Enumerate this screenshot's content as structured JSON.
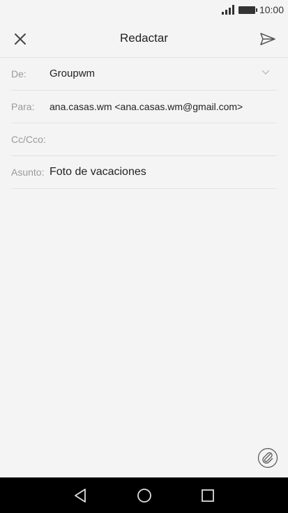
{
  "status_bar": {
    "time": "10:00",
    "icons": [
      "signal-icon",
      "battery-icon"
    ]
  },
  "header": {
    "title": "Redactar",
    "left_icon": "close-icon",
    "right_icon": "send-icon"
  },
  "form": {
    "from": {
      "label": "De:",
      "value": "Groupwm",
      "icon": "chevron-down-icon"
    },
    "to": {
      "label": "Para:",
      "value": "ana.casas.wm <ana.casas.wm@gmail.com>"
    },
    "cc_bcc": {
      "label": "Cc/Cco:",
      "value": ""
    },
    "subject": {
      "label": "Asunto:",
      "value": "Foto de vacaciones"
    }
  },
  "attach": {
    "icon": "paperclip-icon"
  },
  "navigation": {
    "icons": [
      "back-icon",
      "home-icon",
      "recents-icon"
    ]
  },
  "colors": {
    "background": "#f4f4f4",
    "divider": "#e2e2e2",
    "nav_bar": "#000000",
    "label": "#9a9a9a"
  }
}
